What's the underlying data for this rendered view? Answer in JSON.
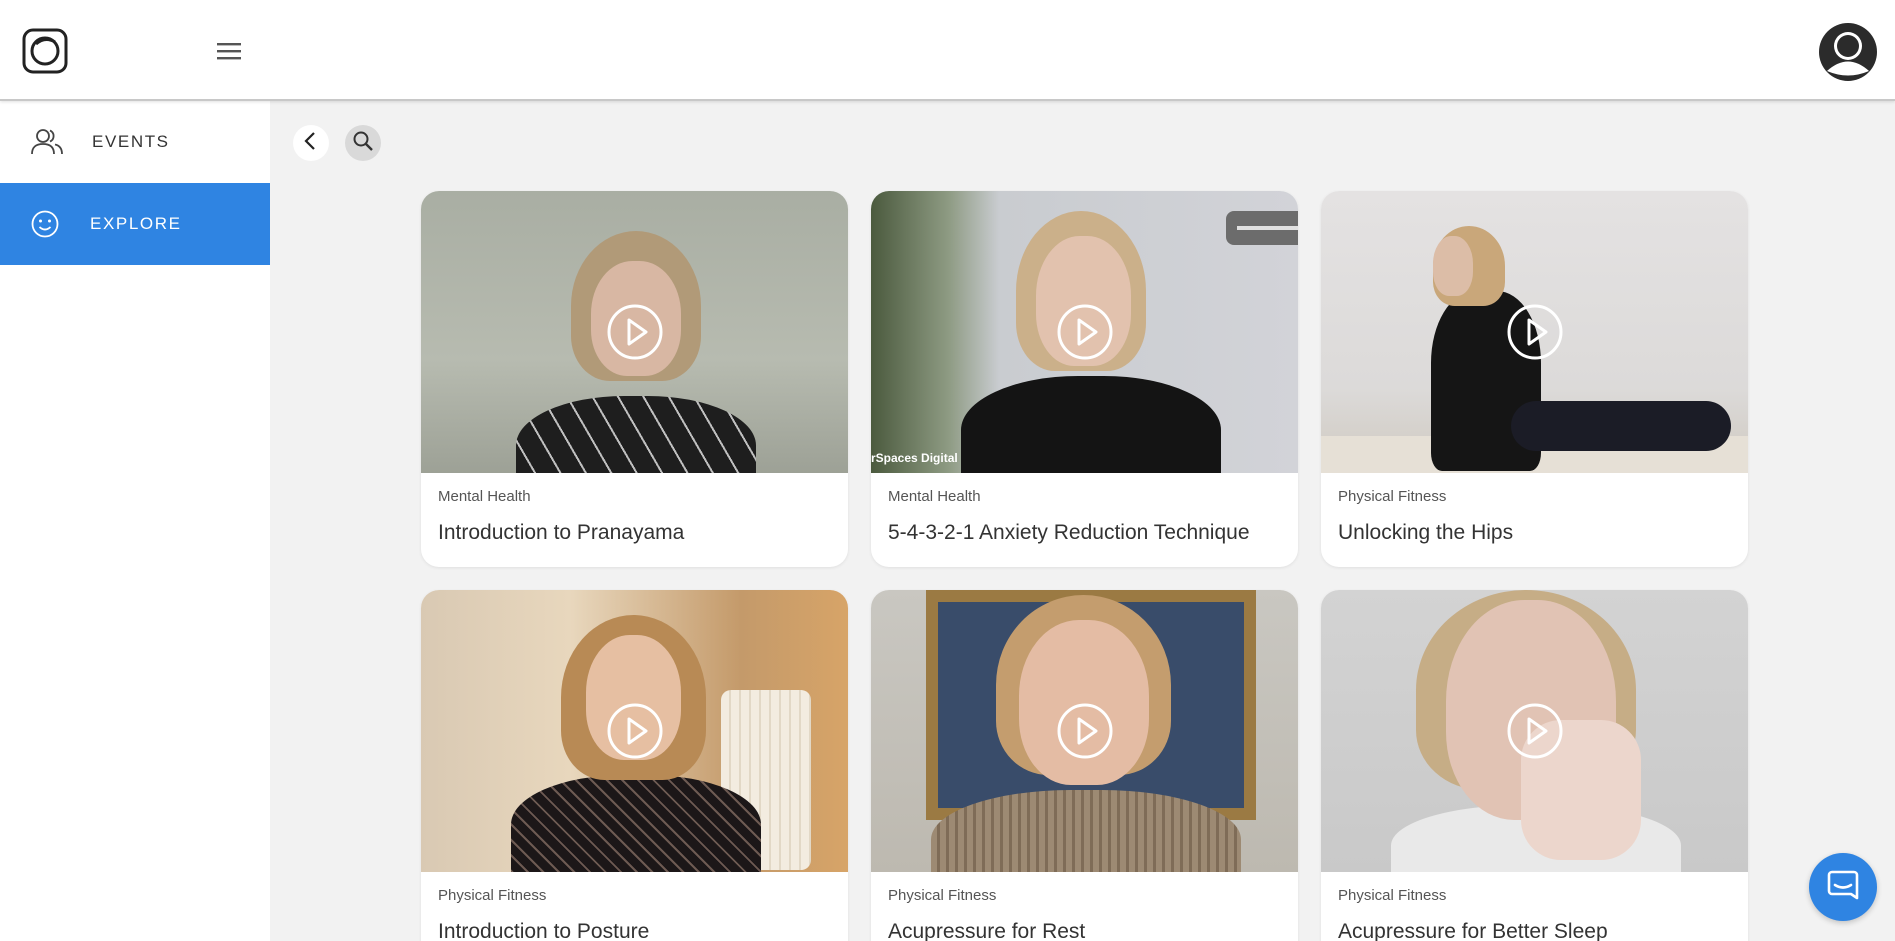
{
  "colors": {
    "accent": "#2f84e2",
    "background": "#f2f2f2",
    "card": "#ffffff"
  },
  "header": {
    "logo_icon": "app-logo-icon",
    "menu_icon": "hamburger-menu-icon",
    "avatar_icon": "user-avatar-icon"
  },
  "sidebar": {
    "items": [
      {
        "label": "EVENTS",
        "icon": "people-icon",
        "active": false
      },
      {
        "label": "EXPLORE",
        "icon": "smiley-icon",
        "active": true
      }
    ]
  },
  "toolbar": {
    "back_icon": "chevron-left-icon",
    "search_icon": "search-icon"
  },
  "videos": [
    {
      "category": "Mental Health",
      "title": "Introduction to Pranayama"
    },
    {
      "category": "Mental Health",
      "title": "5-4-3-2-1 Anxiety Reduction Technique",
      "overlay_text": "rSpaces Digital"
    },
    {
      "category": "Physical Fitness",
      "title": "Unlocking the Hips"
    },
    {
      "category": "Physical Fitness",
      "title": "Introduction to Posture"
    },
    {
      "category": "Physical Fitness",
      "title": "Acupressure for Rest"
    },
    {
      "category": "Physical Fitness",
      "title": "Acupressure for Better Sleep"
    }
  ],
  "chat": {
    "icon": "chat-bubble-icon"
  }
}
